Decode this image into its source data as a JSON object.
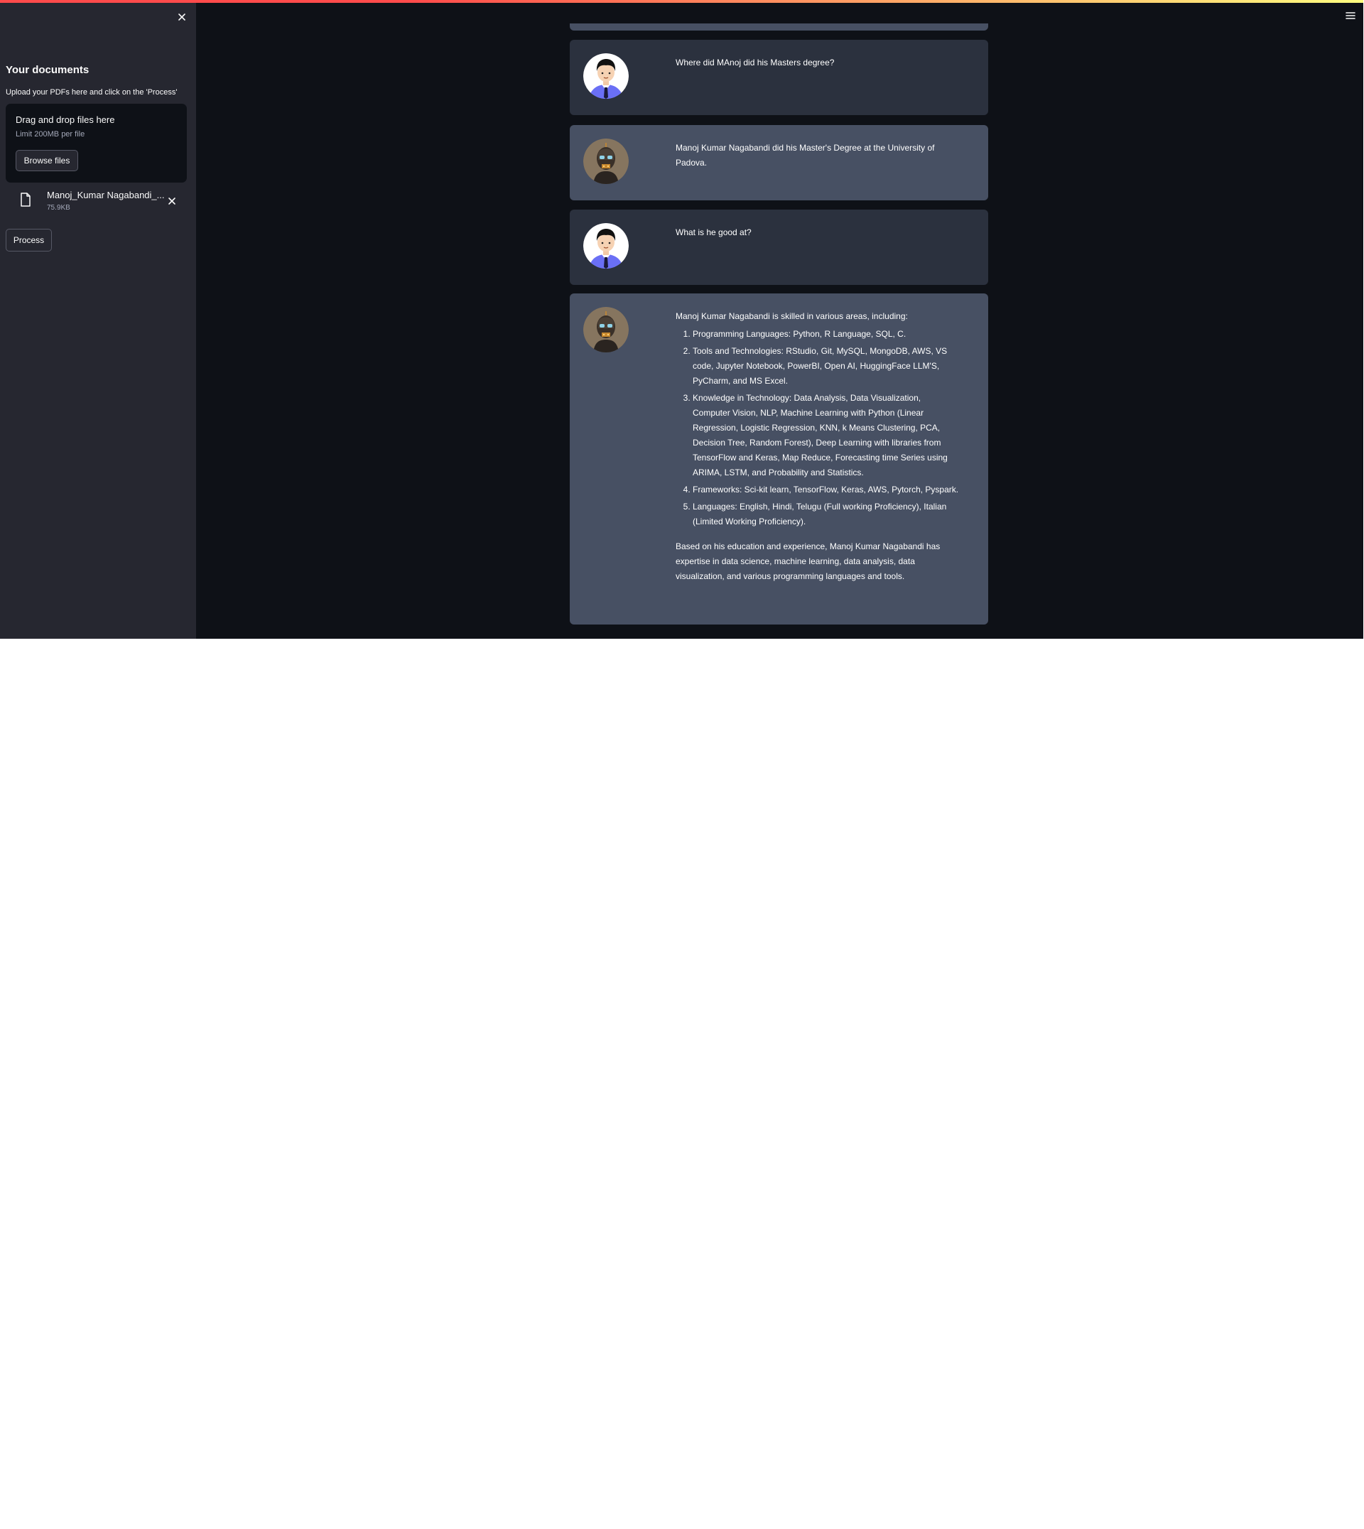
{
  "sidebar": {
    "title": "Your documents",
    "caption": "Upload your PDFs here and click on the 'Process'",
    "dropzone": {
      "title": "Drag and drop files here",
      "limit": "Limit 200MB per file",
      "browse_label": "Browse files"
    },
    "file": {
      "name": "Manoj_Kumar Nagabandi_...",
      "size": "75.9KB"
    },
    "process_label": "Process"
  },
  "chat": {
    "messages": [
      {
        "role": "user",
        "text": "Where did MAnoj did his Masters degree?"
      },
      {
        "role": "bot",
        "text": "Manoj Kumar Nagabandi did his Master's Degree at the University of Padova."
      },
      {
        "role": "user",
        "text": "What is he good at?"
      },
      {
        "role": "bot",
        "intro": "Manoj Kumar Nagabandi is skilled in various areas, including:",
        "items": [
          "Programming Languages: Python, R Language, SQL, C.",
          "Tools and Technologies: RStudio, Git, MySQL, MongoDB, AWS, VS code, Jupyter Notebook, PowerBI, Open AI, HuggingFace LLM'S, PyCharm, and MS Excel.",
          "Knowledge in Technology: Data Analysis, Data Visualization, Computer Vision, NLP, Machine Learning with Python (Linear Regression, Logistic Regression, KNN, k Means Clustering, PCA, Decision Tree, Random Forest), Deep Learning with libraries from TensorFlow and Keras, Map Reduce, Forecasting time Series using ARIMA, LSTM, and Probability and Statistics.",
          "Frameworks: Sci-kit learn, TensorFlow, Keras, AWS, Pytorch, Pyspark.",
          "Languages: English, Hindi, Telugu (Full working Proficiency), Italian (Limited Working Proficiency)."
        ],
        "outro": "Based on his education and experience, Manoj Kumar Nagabandi has expertise in data science, machine learning, data analysis, data visualization, and various programming languages and tools."
      }
    ]
  },
  "icons": {
    "sidebar_close": "close-icon",
    "file": "file-icon",
    "file_remove": "close-icon",
    "menu": "hamburger-menu-icon",
    "user_avatar": "user-avatar",
    "bot_avatar": "bot-avatar"
  },
  "colors": {
    "app_background": "#0e1117",
    "sidebar_background": "#262730",
    "user_message_background": "#2b313e",
    "bot_message_background": "#475063",
    "text": "#fafafa",
    "accent_decoration": "#ff4b4b"
  }
}
